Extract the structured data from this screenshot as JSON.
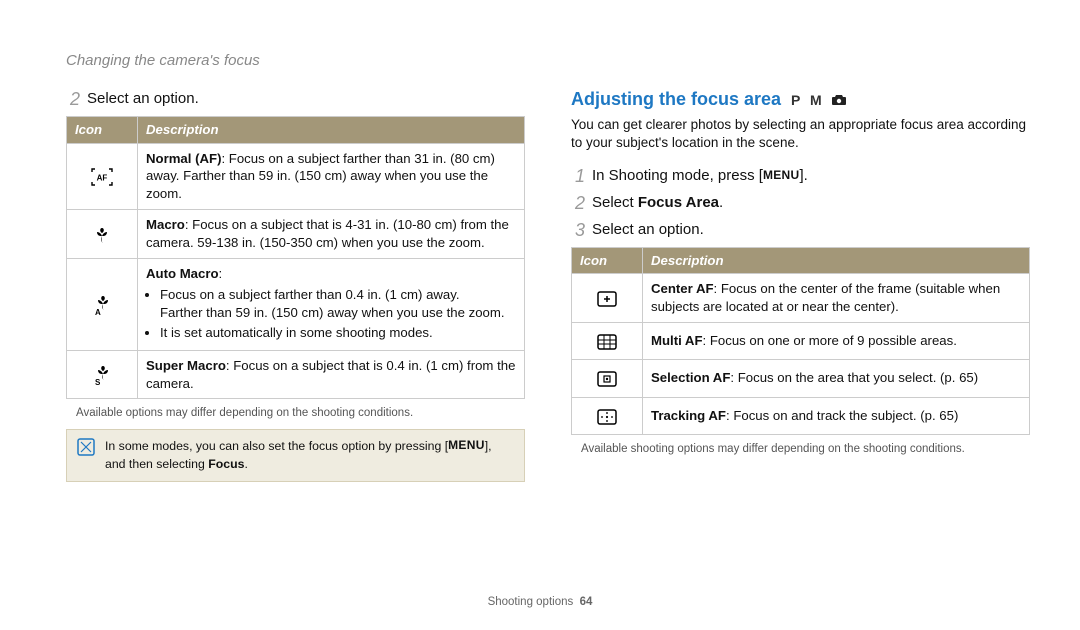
{
  "section_title": "Changing the camera's focus",
  "left": {
    "step2": {
      "num": "2",
      "text": "Select an option."
    },
    "table_headers": {
      "icon": "Icon",
      "desc": "Description"
    },
    "rows": [
      {
        "icon": "normal-af-icon",
        "html": "<b>Normal (AF)</b>: Focus on a subject farther than 31 in. (80 cm) away. Farther than 59 in. (150 cm) away when you use the zoom."
      },
      {
        "icon": "macro-icon",
        "html": "<b>Macro</b>: Focus on a subject that is 4-31 in. (10-80 cm) from the camera. 59-138 in. (150-350 cm) when you use the zoom."
      },
      {
        "icon": "auto-macro-icon",
        "html": "<b>Auto Macro</b>:<ul class='bul'><li>Focus on a subject farther than 0.4 in. (1 cm) away.<br/>Farther than 59 in. (150 cm) away when you use the zoom.</li><li>It is set automatically in some shooting modes.</li></ul>"
      },
      {
        "icon": "super-macro-icon",
        "html": "<b>Super Macro</b>: Focus on a subject that is 0.4 in. (1 cm) from the camera."
      }
    ],
    "footnote": "Available options may differ depending on the shooting conditions.",
    "note": {
      "pre": "In some modes, you can also set the focus option by pressing [",
      "key": "MENU",
      "post": "], and then selecting ",
      "bold": "Focus",
      "end": "."
    }
  },
  "right": {
    "heading": "Adjusting the focus area",
    "modes": "P M",
    "lead": "You can get clearer photos by selecting an appropriate focus area according to your subject's location in the scene.",
    "steps": [
      {
        "num": "1",
        "pre": "In Shooting mode, press [",
        "key": "MENU",
        "post": "]."
      },
      {
        "num": "2",
        "pre": "Select ",
        "bold": "Focus Area",
        "post": "."
      },
      {
        "num": "3",
        "text": "Select an option."
      }
    ],
    "table_headers": {
      "icon": "Icon",
      "desc": "Description"
    },
    "rows": [
      {
        "icon": "center-af-icon",
        "html": "<b>Center AF</b>: Focus on the center of the frame (suitable when subjects are located at or near the center)."
      },
      {
        "icon": "multi-af-icon",
        "html": "<b>Multi AF</b>: Focus on one or more of 9 possible areas."
      },
      {
        "icon": "selection-af-icon",
        "html": "<b>Selection AF</b>: Focus on the area that you select. (p. 65)"
      },
      {
        "icon": "tracking-af-icon",
        "html": "<b>Tracking AF</b>: Focus on and track the subject. (p. 65)"
      }
    ],
    "footnote": "Available shooting options may differ depending on the shooting conditions."
  },
  "footer": {
    "label": "Shooting options",
    "page": "64"
  }
}
